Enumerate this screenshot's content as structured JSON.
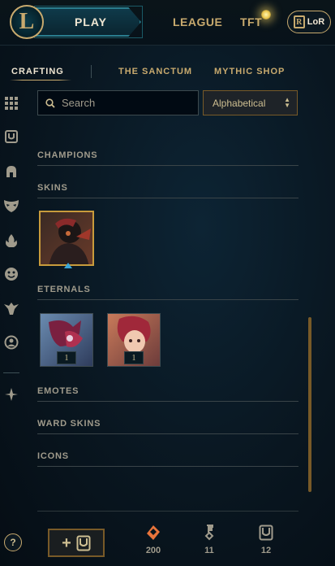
{
  "topbar": {
    "logo_glyph": "L",
    "play_label": "PLAY",
    "nav": [
      "LEAGUE",
      "TFT"
    ],
    "lor_label": "LoR",
    "lor_glyph": "R"
  },
  "subtabs": [
    "CRAFTING",
    "THE SANCTUM",
    "MYTHIC SHOP"
  ],
  "rail_icons": [
    "grid-icon",
    "chest-icon",
    "helmet-icon",
    "mask-icon",
    "flame-icon",
    "emote-icon",
    "ward-icon",
    "profile-icon",
    "chroma-icon"
  ],
  "search": {
    "placeholder": "Search",
    "value": ""
  },
  "sort": {
    "selected": "Alphabetical",
    "arrows": "▲▼"
  },
  "sections": {
    "champions": "CHAMPIONS",
    "skins": "SKINS",
    "eternals": "ETERNALS",
    "emotes": "EMOTES",
    "ward_skins": "WARD SKINS",
    "icons": "ICONS"
  },
  "skins_items": [
    {
      "name": "skin-shard",
      "count": ""
    }
  ],
  "eternals_items": [
    {
      "name": "eternal-shard",
      "count": "1"
    },
    {
      "name": "eternal-shard",
      "count": "1"
    }
  ],
  "bottom": {
    "help_label": "?",
    "add_label": "+",
    "currencies": [
      {
        "icon": "essence-icon",
        "value": "200"
      },
      {
        "icon": "key-icon",
        "value": "11"
      },
      {
        "icon": "chest-icon",
        "value": "12"
      }
    ]
  },
  "colors": {
    "gold": "#c8aa6e",
    "accent_blue": "#3aa6d8",
    "essence_orange": "#e8743b"
  }
}
